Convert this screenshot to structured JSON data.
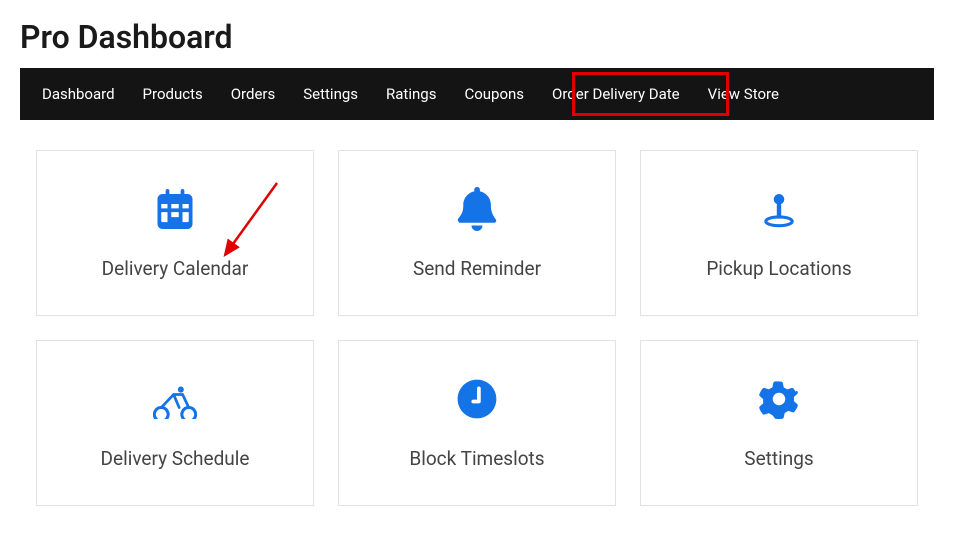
{
  "page_title": "Pro Dashboard",
  "nav": {
    "items": [
      "Dashboard",
      "Products",
      "Orders",
      "Settings",
      "Ratings",
      "Coupons",
      "Order Delivery Date",
      "View Store"
    ],
    "highlighted_index": 6
  },
  "cards": [
    {
      "icon": "calendar-icon",
      "title": "Delivery Calendar"
    },
    {
      "icon": "bell-icon",
      "title": "Send Reminder"
    },
    {
      "icon": "pin-icon",
      "title": "Pickup Locations"
    },
    {
      "icon": "bicycle-icon",
      "title": "Delivery Schedule"
    },
    {
      "icon": "clock-icon",
      "title": "Block Timeslots"
    },
    {
      "icon": "gear-icon",
      "title": "Settings"
    }
  ],
  "colors": {
    "accent": "#1473e6",
    "highlight_border": "#e10000",
    "nav_bg": "#141414"
  },
  "annotations": {
    "red_arrow_target": "Delivery Calendar"
  }
}
